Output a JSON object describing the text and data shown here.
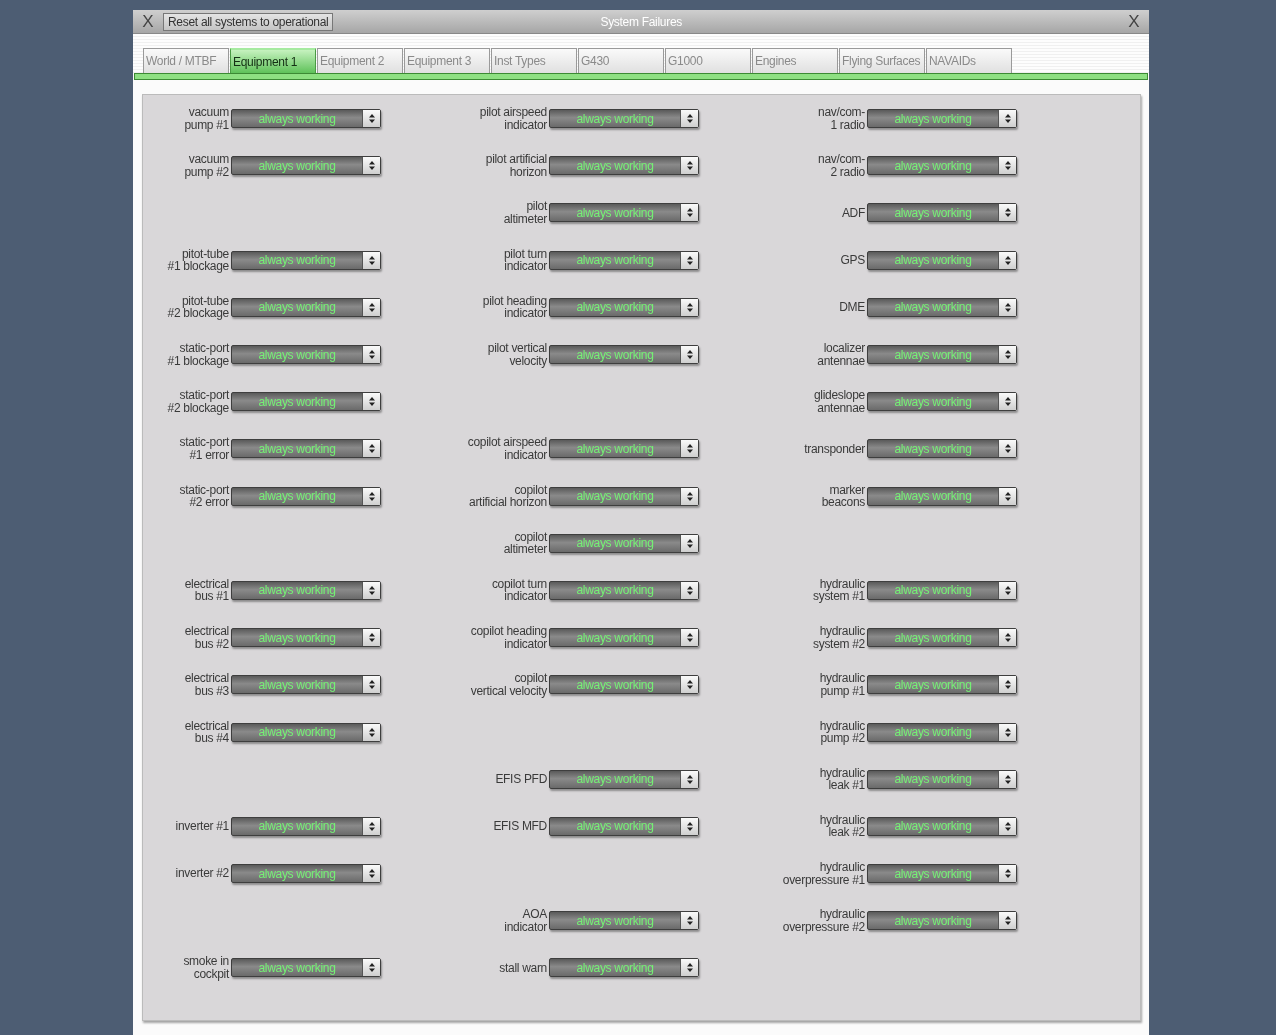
{
  "window": {
    "title": "System Failures",
    "close_left": "X",
    "close_right": "X"
  },
  "reset_button": "Reset all systems to operational",
  "tabs": [
    {
      "label": "World / MTBF",
      "selected": false
    },
    {
      "label": "Equipment 1",
      "selected": true
    },
    {
      "label": "Equipment 2",
      "selected": false
    },
    {
      "label": "Equipment 3",
      "selected": false
    },
    {
      "label": "Inst Types",
      "selected": false
    },
    {
      "label": "G430",
      "selected": false
    },
    {
      "label": "G1000",
      "selected": false
    },
    {
      "label": "Engines",
      "selected": false
    },
    {
      "label": "Flying Surfaces",
      "selected": false
    },
    {
      "label": "NAVAIDs",
      "selected": false
    }
  ],
  "failure_columns": [
    [
      {
        "label": "vacuum\npump #1",
        "value": "always working"
      },
      {
        "label": "vacuum\npump #2",
        "value": "always working"
      },
      null,
      {
        "label": "pitot-tube\n#1 blockage",
        "value": "always working"
      },
      {
        "label": "pitot-tube\n#2 blockage",
        "value": "always working"
      },
      {
        "label": "static-port\n#1 blockage",
        "value": "always working"
      },
      {
        "label": "static-port\n#2 blockage",
        "value": "always working"
      },
      {
        "label": "static-port\n#1 error",
        "value": "always working"
      },
      {
        "label": "static-port\n#2 error",
        "value": "always working"
      },
      null,
      {
        "label": "electrical\nbus #1",
        "value": "always working"
      },
      {
        "label": "electrical\nbus #2",
        "value": "always working"
      },
      {
        "label": "electrical\nbus #3",
        "value": "always working"
      },
      {
        "label": "electrical\nbus #4",
        "value": "always working"
      },
      null,
      {
        "label": "inverter #1",
        "value": "always working"
      },
      {
        "label": "inverter #2",
        "value": "always working"
      },
      null,
      {
        "label": "smoke in\ncockpit",
        "value": "always working"
      }
    ],
    [
      {
        "label": "pilot airspeed\nindicator",
        "value": "always working"
      },
      {
        "label": "pilot artificial\nhorizon",
        "value": "always working"
      },
      {
        "label": "pilot\naltimeter",
        "value": "always working"
      },
      {
        "label": "pilot turn\nindicator",
        "value": "always working"
      },
      {
        "label": "pilot heading\nindicator",
        "value": "always working"
      },
      {
        "label": "pilot vertical\nvelocity",
        "value": "always working"
      },
      null,
      {
        "label": "copilot airspeed\nindicator",
        "value": "always working"
      },
      {
        "label": "copilot\nartificial horizon",
        "value": "always working"
      },
      {
        "label": "copilot\naltimeter",
        "value": "always working"
      },
      {
        "label": "copilot turn\nindicator",
        "value": "always working"
      },
      {
        "label": "copilot heading\nindicator",
        "value": "always working"
      },
      {
        "label": "copilot\nvertical velocity",
        "value": "always working"
      },
      null,
      {
        "label": "EFIS PFD",
        "value": "always working"
      },
      {
        "label": "EFIS MFD",
        "value": "always working"
      },
      null,
      {
        "label": "AOA\nindicator",
        "value": "always working"
      },
      {
        "label": "stall warn",
        "value": "always working"
      }
    ],
    [
      {
        "label": "nav/com-\n1 radio",
        "value": "always working"
      },
      {
        "label": "nav/com-\n2 radio",
        "value": "always working"
      },
      {
        "label": "ADF",
        "value": "always working"
      },
      {
        "label": "GPS",
        "value": "always working"
      },
      {
        "label": "DME",
        "value": "always working"
      },
      {
        "label": "localizer\nantennae",
        "value": "always working"
      },
      {
        "label": "glideslope\nantennae",
        "value": "always working"
      },
      {
        "label": "transponder",
        "value": "always working"
      },
      {
        "label": "marker\nbeacons",
        "value": "always working"
      },
      null,
      {
        "label": "hydraulic\nsystem #1",
        "value": "always working"
      },
      {
        "label": "hydraulic\nsystem #2",
        "value": "always working"
      },
      {
        "label": "hydraulic\npump #1",
        "value": "always working"
      },
      {
        "label": "hydraulic\npump #2",
        "value": "always working"
      },
      {
        "label": "hydraulic\nleak #1",
        "value": "always working"
      },
      {
        "label": "hydraulic\nleak #2",
        "value": "always working"
      },
      {
        "label": "hydraulic\noverpressure #1",
        "value": "always working"
      },
      {
        "label": "hydraulic\noverpressure #2",
        "value": "always working"
      },
      null
    ]
  ]
}
